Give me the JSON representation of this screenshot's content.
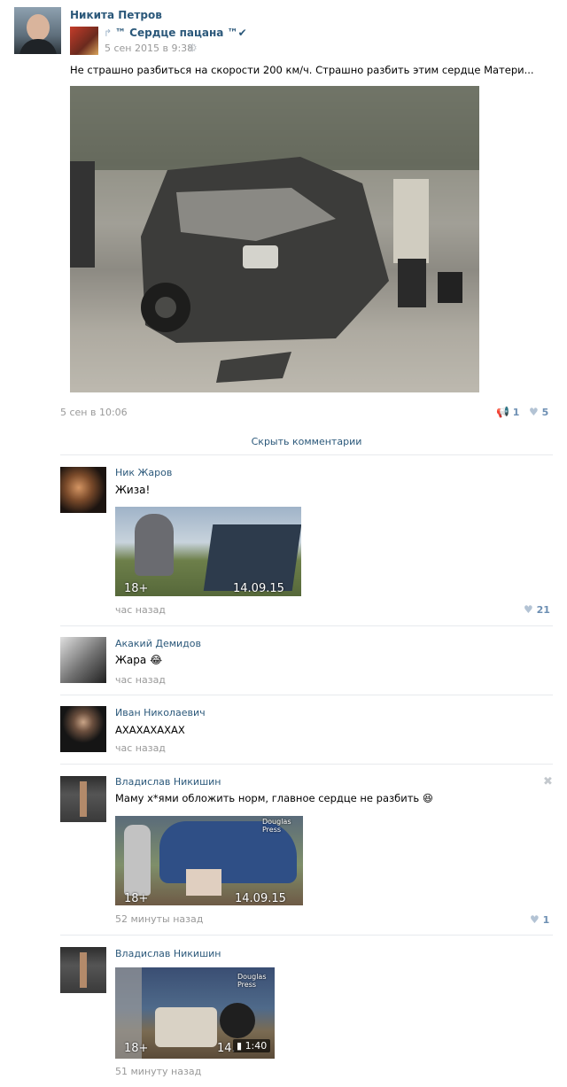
{
  "post": {
    "author": "Никита Петров",
    "repost_source": "™ Сердце пацана ™✔",
    "repost_date": "5 сен 2015 в 9:38",
    "text": "Не страшно разбиться на скорости 200 км/ч. Страшно разбить этим сердце Матери...",
    "date": "5 сен в 10:06",
    "reposts": "1",
    "likes": "5",
    "hide_comments": "Скрыть комментарии"
  },
  "comments": [
    {
      "author": "Ник Жаров",
      "text": "Жиза!",
      "time": "час назад",
      "likes": "21",
      "thumb_age": "18+",
      "thumb_date": "14.09.15"
    },
    {
      "author": "Акакий Демидов",
      "text": "Жара 😂",
      "time": "час назад"
    },
    {
      "author": "Иван Николаевич",
      "text": "АХАХАХАХАХ",
      "time": "час назад"
    },
    {
      "author": "Владислав Никишин",
      "text": "Маму х*ями обложить норм, главное сердце не разбить 😆",
      "time": "52 минуты назад",
      "likes": "1",
      "thumb_age": "18+",
      "thumb_date": "14.09.15",
      "thumb_brand": "Douglas Press"
    },
    {
      "author": "Владислав Никишин",
      "text": "",
      "time": "51 минуту назад",
      "thumb_age": "18+",
      "thumb_date": "14.",
      "thumb_duration": "1:40",
      "thumb_brand": "Douglas Press"
    }
  ],
  "icons": {
    "repost": "repost-icon",
    "heart": "heart-icon",
    "verified": "verified-icon",
    "settings": "gear-icon",
    "close": "close-icon",
    "video": "video-icon"
  }
}
